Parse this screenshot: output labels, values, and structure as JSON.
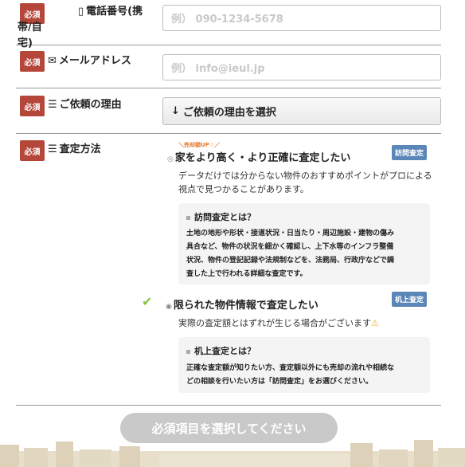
{
  "badge_required": "必須",
  "phone": {
    "label_line1": "電話番号(携帯/自",
    "label_line2": "宅)",
    "icon": "phone-icon",
    "placeholder": "例） 090-1234-5678"
  },
  "email": {
    "label": "メールアドレス",
    "icon": "mail-icon",
    "placeholder": "例） info@ieul.jp"
  },
  "reason": {
    "label": "ご依頼の理由",
    "icon": "list-icon",
    "select_label": "ご依頼の理由を選択"
  },
  "method": {
    "label": "査定方法",
    "icon": "list-icon",
    "options": [
      {
        "up_tag": "＼売却額UP☆／",
        "title": "家をより高く・より正確に査定したい",
        "badge": "訪問査定",
        "desc_line1": "データだけでは分からない物件のおすすめポイントがプロによる",
        "desc_line2": "視点で見つかることがあります。",
        "box_title": "訪問査定とは？",
        "box_lines": [
          "土地の地形や形状・接道状況・日当たり・周辺施設・建物の傷み",
          "具合など、物件の状況を細かく確認し、上下水等のインフラ整備",
          "状況、物件の登記記録や法規制などを、法務局、行政庁などで調",
          "査した上で行われる詳細な査定です。"
        ]
      },
      {
        "title": "限られた物件情報で査定したい",
        "badge": "机上査定",
        "desc_line1": "実際の査定額とはずれが生じる場合がございます",
        "box_title": "机上査定とは？",
        "box_lines": [
          "正確な査定額が知りたい方、査定額以外にも売却の流れや相続な",
          "どの相談を行いたい方は「訪問査定」をお選びください。"
        ]
      }
    ]
  },
  "submit_label": "必須項目を選択してください",
  "colors": {
    "required": "#b5473a",
    "badge_blue": "#5b87b8",
    "check": "#8cbf4a",
    "submit_disabled": "#c9c9c9"
  }
}
